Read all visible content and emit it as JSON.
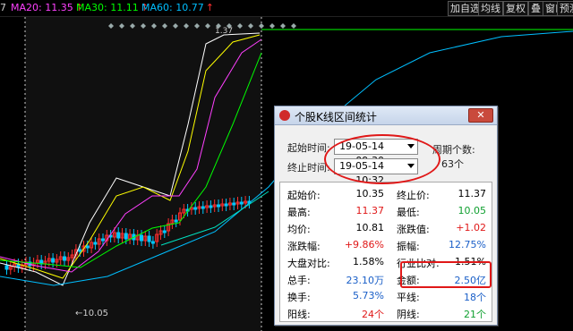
{
  "toolbar": {
    "ma_prefix": "7",
    "ma20": "MA20: 11.35",
    "ma30": "MA30: 11.11",
    "ma60": "MA60: 10.77",
    "arrow": "↑",
    "buttons": [
      "加自选",
      "均线",
      "复权",
      "叠",
      "窗口",
      "预测"
    ]
  },
  "chart": {
    "low_label": "10.05",
    "top_label": "1.37",
    "colors": {
      "up": "#ff2d2d",
      "down": "#00c8ff",
      "ma5": "#ffffff",
      "ma10": "#ffff00",
      "ma20": "#ff40ff",
      "ma30": "#00ff00",
      "ma60": "#00bfff",
      "ma_other": "#00e0c0"
    }
  },
  "dialog": {
    "title": "个股K线区间统计",
    "start_label": "起始时间:",
    "start_value": "19-05-14 09:30",
    "end_label": "终止时间:",
    "end_value": "19-05-14 10:32",
    "period_label": "周期个数:",
    "period_value": "63个",
    "stats_left": [
      {
        "k": "起始价:",
        "v": "10.35",
        "c": "black"
      },
      {
        "k": "最高:",
        "v": "11.37",
        "c": "red"
      },
      {
        "k": "均价:",
        "v": "10.81",
        "c": "black"
      },
      {
        "k": "涨跌幅:",
        "v": "+9.86%",
        "c": "red"
      },
      {
        "k": "大盘对比:",
        "v": "1.58%",
        "c": "black"
      },
      {
        "k": "总手:",
        "v": "23.10万",
        "c": "blue"
      },
      {
        "k": "换手:",
        "v": "5.73%",
        "c": "blue"
      },
      {
        "k": "阳线:",
        "v": "24个",
        "c": "red"
      }
    ],
    "stats_right": [
      {
        "k": "终止价:",
        "v": "11.37",
        "c": "black"
      },
      {
        "k": "最低:",
        "v": "10.05",
        "c": "green"
      },
      {
        "k": "涨跌值:",
        "v": "+1.02",
        "c": "red"
      },
      {
        "k": "振幅:",
        "v": "12.75%",
        "c": "blue"
      },
      {
        "k": "行业比对:",
        "v": "1.51%",
        "c": "black"
      },
      {
        "k": "金额:",
        "v": "2.50亿",
        "c": "blue"
      },
      {
        "k": "平线:",
        "v": "18个",
        "c": "blue"
      },
      {
        "k": "阴线:",
        "v": "21个",
        "c": "green"
      }
    ]
  }
}
